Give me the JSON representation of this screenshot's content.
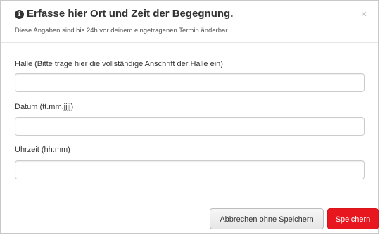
{
  "dialog": {
    "title": "Erfasse hier Ort und Zeit der Begegnung.",
    "subtitle": "Diese Angaben sind bis 24h vor deinem eingetragenen Termin änderbar",
    "close_icon": "×",
    "info_icon": "i"
  },
  "form": {
    "fields": [
      {
        "label": "Halle (Bitte trage hier die vollständige Anschrift der Halle ein)",
        "value": "",
        "placeholder": ""
      },
      {
        "label": "Datum (tt.mm.jjjj)",
        "value": "",
        "placeholder": ""
      },
      {
        "label": "Uhrzeit (hh:mm)",
        "value": "",
        "placeholder": ""
      }
    ]
  },
  "footer": {
    "cancel_label": "Abbrechen ohne Speichern",
    "save_label": "Speichern"
  },
  "colors": {
    "accent": "#e8171f",
    "border": "#cccccc",
    "text": "#333333"
  }
}
